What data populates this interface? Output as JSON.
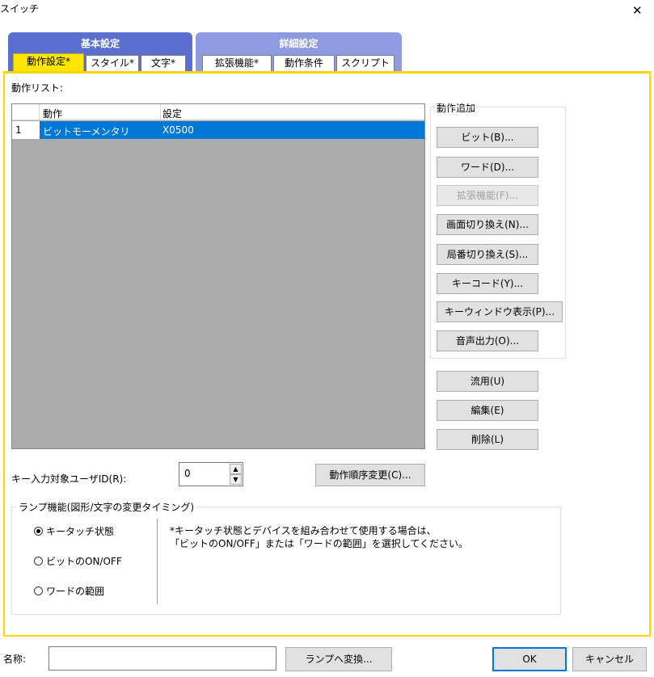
{
  "window": {
    "title": "スイッチ",
    "close_glyph": "✕"
  },
  "tab_groups": [
    {
      "label": "基本設定",
      "color": "#5a6fd0",
      "tabs": [
        "動作設定*",
        "スタイル*",
        "文字*"
      ]
    },
    {
      "label": "詳細設定",
      "color": "#8e9be0",
      "tabs": [
        "拡張機能*",
        "動作条件",
        "スクリプト"
      ]
    }
  ],
  "action_list": {
    "label": "動作リスト:",
    "columns": [
      "動作",
      "設定"
    ],
    "rows": [
      {
        "no": "1",
        "action": "ビットモーメンタリ",
        "setting": "X0500"
      }
    ]
  },
  "add_action": {
    "label": "動作追加",
    "buttons": [
      {
        "label": "ビット(B)...",
        "enabled": true
      },
      {
        "label": "ワード(D)...",
        "enabled": true
      },
      {
        "label": "拡張機能(F)...",
        "enabled": false
      },
      {
        "label": "画面切り換え(N)...",
        "enabled": true
      },
      {
        "label": "局番切り換え(S)...",
        "enabled": true
      },
      {
        "label": "キーコード(Y)...",
        "enabled": true
      },
      {
        "label": "キーウィンドウ表示(P)...",
        "enabled": true
      },
      {
        "label": "音声出力(O)...",
        "enabled": true
      }
    ]
  },
  "list_buttons": [
    "流用(U)",
    "編集(E)",
    "削除(L)"
  ],
  "key_input": {
    "label": "キー入力対象ユーザID(R):",
    "value": "0"
  },
  "reorder_button": "動作順序変更(C)...",
  "lamp": {
    "label": "ランプ機能(図形/文字の変更タイミング)",
    "options": [
      {
        "label": "キータッチ状態",
        "selected": true
      },
      {
        "label": "ビットのON/OFF",
        "selected": false
      },
      {
        "label": "ワードの範囲",
        "selected": false
      }
    ],
    "note_line1": "*キータッチ状態とデバイスを組み合わせて使用する場合は、",
    "note_line2": "「ビットのON/OFF」または「ワードの範囲」を選択してください。"
  },
  "footer": {
    "name_label": "名称:",
    "name_value": "",
    "convert_button": "ランプへ変換...",
    "ok_button": "OK",
    "cancel_button": "キャンセル"
  },
  "colors": {
    "selection": "#0078d7",
    "list_bg": "#ababab",
    "panel_border": "#ffd700"
  }
}
